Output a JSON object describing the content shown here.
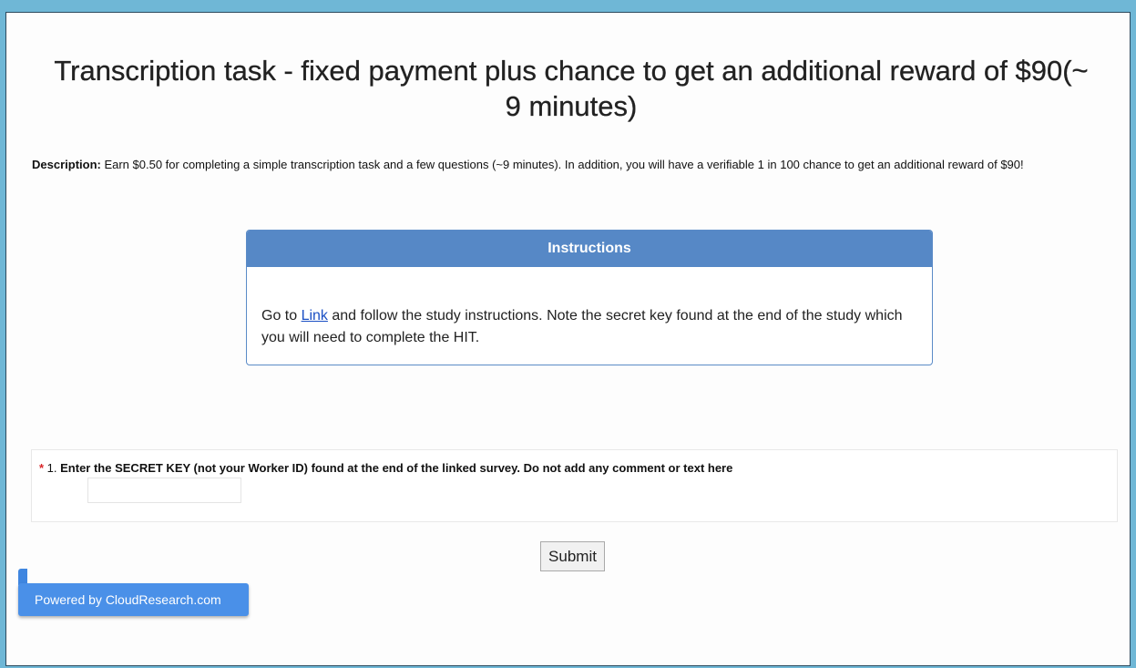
{
  "page": {
    "title": "Transcription task - fixed payment plus chance to get an additional reward of $90(~ 9 minutes)"
  },
  "description": {
    "label": "Description:",
    "text": " Earn $0.50 for completing a simple transcription task and a few questions (~9 minutes). In addition, you will have a verifiable 1 in 100 chance to get an additional reward of $90!"
  },
  "instructions": {
    "heading": "Instructions",
    "text_before": "Go to ",
    "link_label": "Link",
    "text_after": " and follow the study instructions. Note the secret key found at the end of the study which you will need to complete the HIT."
  },
  "question": {
    "required_mark": "*",
    "number": " 1. ",
    "label": "Enter the SECRET KEY (not your Worker ID) found at the end of the linked survey. Do not add any comment or text here",
    "value": "",
    "placeholder": ""
  },
  "submit_label": "Submit",
  "powered_by": "Powered by CloudResearch.com",
  "colors": {
    "background": "#6fb7d6",
    "panel_header": "#5688c6",
    "required": "#d9262a",
    "link": "#1a4fc4",
    "badge": "#4a90e8"
  }
}
